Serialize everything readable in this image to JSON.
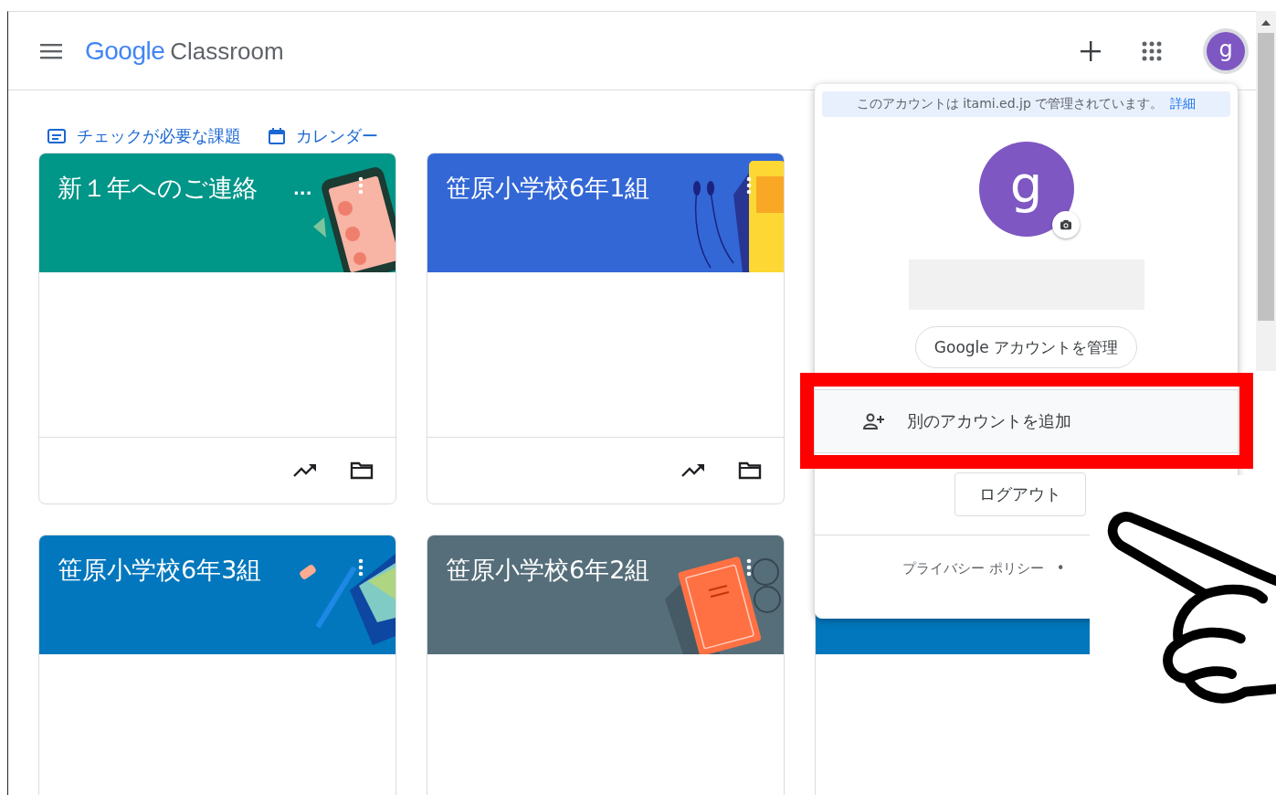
{
  "header": {
    "brand": "Google",
    "product": "Classroom",
    "avatar_letter": "g"
  },
  "quick_links": [
    {
      "kind": "todo",
      "label": "チェックが必要な課題"
    },
    {
      "kind": "calendar",
      "label": "カレンダー"
    }
  ],
  "class_rows": [
    [
      {
        "title": "新１年へのご連絡",
        "more": "...",
        "color": "#009688",
        "kind": "phone"
      },
      {
        "title": "笹原小学校6年1組",
        "color": "#3367d6",
        "kind": "earphones"
      }
    ],
    [
      {
        "title": "笹原小学校6年3組",
        "color": "#0277bd",
        "kind": "pencil"
      },
      {
        "title": "笹原小学校6年2組",
        "color": "#566e7a",
        "kind": "notebook"
      },
      {
        "color": "#0277bd"
      }
    ]
  ],
  "account_menu": {
    "notice": "このアカウントは itami.ed.jp で管理されています。",
    "notice_link": "詳細",
    "avatar_letter": "g",
    "manage_button": "Google アカウントを管理",
    "add_account": "別のアカウントを追加",
    "sign_out": "ログアウト",
    "privacy": "プライバシー ポリシー",
    "separator": "•"
  }
}
